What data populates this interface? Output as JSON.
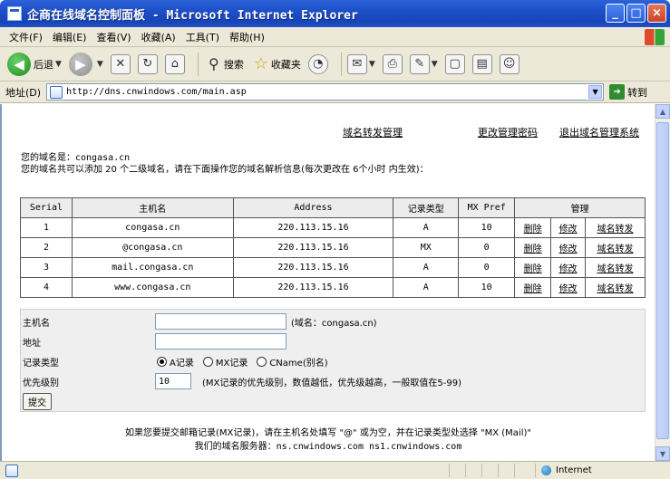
{
  "window": {
    "title": "企商在线域名控制面板 - Microsoft Internet Explorer",
    "min_label": "_",
    "max_label": "□",
    "close_label": "×"
  },
  "menu": [
    "文件(F)",
    "编辑(E)",
    "查看(V)",
    "收藏(A)",
    "工具(T)",
    "帮助(H)"
  ],
  "toolbar": {
    "back_label": "后退",
    "search_label": "搜索",
    "favorites_label": "收藏夹"
  },
  "address": {
    "label": "地址(D)",
    "url": "http://dns.cnwindows.com/main.asp",
    "go_label": "转到"
  },
  "links": {
    "forward_mgmt": "域名转发管理",
    "change_password": "更改管理密码",
    "logout": "退出域名管理系统"
  },
  "info": {
    "domain_label": "您的域名是：",
    "domain": "congasa.cn",
    "quota_line": "您的域名共可以添加 20 个二级域名，请在下面操作您的域名解析信息(每次更改在 6个小时 内生效)："
  },
  "table": {
    "headers": [
      "Serial",
      "主机名",
      "Address",
      "记录类型",
      "MX Pref",
      "管理"
    ],
    "action_labels": [
      "删除",
      "修改",
      "域名转发"
    ],
    "rows": [
      {
        "serial": "1",
        "host": "congasa.cn",
        "address": "220.113.15.16",
        "type": "A",
        "mx": "10"
      },
      {
        "serial": "2",
        "host": "@congasa.cn",
        "address": "220.113.15.16",
        "type": "MX",
        "mx": "0"
      },
      {
        "serial": "3",
        "host": "mail.congasa.cn",
        "address": "220.113.15.16",
        "type": "A",
        "mx": "0"
      },
      {
        "serial": "4",
        "host": "www.congasa.cn",
        "address": "220.113.15.16",
        "type": "A",
        "mx": "10"
      }
    ]
  },
  "form": {
    "host_label": "主机名",
    "host_value": "",
    "host_hint": "(域名：congasa.cn)",
    "address_label": "地址",
    "address_value": "",
    "type_label": "记录类型",
    "type_options": [
      "A记录",
      "MX记录",
      "CName(别名)"
    ],
    "type_selected": "A记录",
    "priority_label": "优先级别",
    "priority_value": "10",
    "priority_hint": "(MX记录的优先级别，数值越低，优先级越高，一般取值在5-99)",
    "submit_label": "提交"
  },
  "footer": {
    "line1": "如果您要提交邮箱记录(MX记录)，请在主机名处填写 \"@\" 或为空，并在记录类型处选择 \"MX (Mail)\"",
    "line2_label": "我们的域名服务器：",
    "line2_servers": "ns.cnwindows.com  ns1.cnwindows.com"
  },
  "status": {
    "zone": "Internet"
  }
}
